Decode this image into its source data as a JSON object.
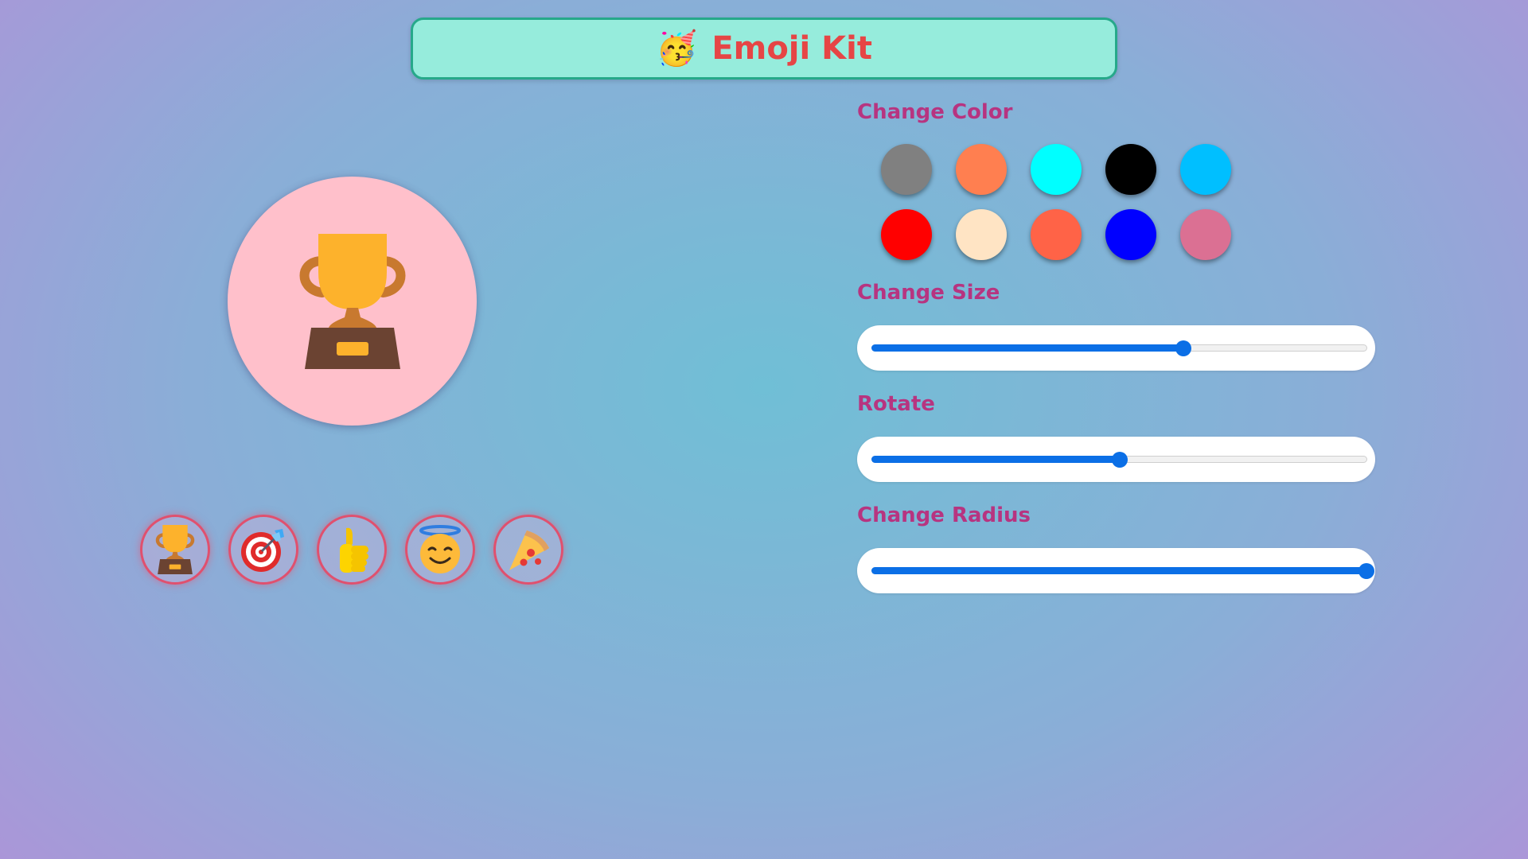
{
  "header": {
    "emoji": "🥳",
    "title": "Emoji Kit"
  },
  "preview": {
    "emoji": "trophy",
    "background": "#ffc0cb"
  },
  "emoji_picker": [
    {
      "name": "trophy"
    },
    {
      "name": "target"
    },
    {
      "name": "thumbs-up"
    },
    {
      "name": "angel"
    },
    {
      "name": "pizza"
    }
  ],
  "controls": {
    "color_label": "Change Color",
    "colors": [
      "#808080",
      "#ff7f50",
      "#00ffff",
      "#000000",
      "#00bfff",
      "#ff0000",
      "#ffe4c4",
      "#ff6347",
      "#0000ff",
      "#db7093"
    ],
    "size_label": "Change Size",
    "size_value": 0.63,
    "rotate_label": "Rotate",
    "rotate_value": 0.5,
    "radius_label": "Change Radius",
    "radius_value": 1.0
  },
  "accent_color": "#0b6fe6"
}
